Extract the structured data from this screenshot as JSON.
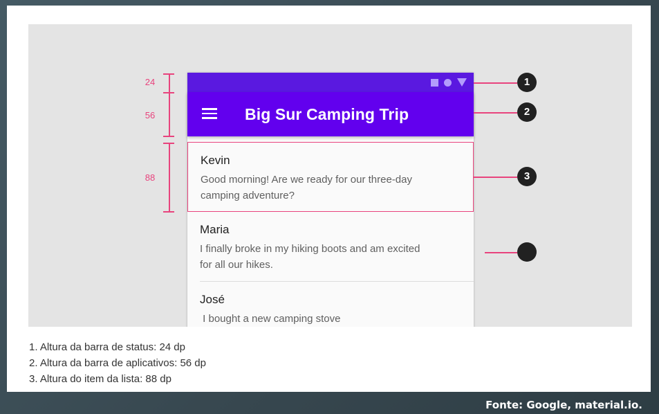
{
  "phone": {
    "app_title": "Big Sur Camping Trip",
    "list": [
      {
        "name": "Kevin",
        "text": "Good morning! Are we ready for our three-day camping adventure?"
      },
      {
        "name": "Maria",
        "text": "I finally broke in my hiking boots and am excited for all our hikes."
      },
      {
        "name": "José",
        "text": " I bought a new camping stove"
      }
    ]
  },
  "dimensions": {
    "status": "24",
    "appbar": "56",
    "item": "88"
  },
  "callouts": [
    "1",
    "2",
    "3"
  ],
  "captions": [
    "1. Altura da barra de status: 24 dp",
    "2. Altura da barra de aplicativos: 56 dp",
    "3. Altura do item da lista: 88 dp"
  ],
  "source": "Fonte: Google, material.io.",
  "colors": {
    "status_bar": "#5a19e0",
    "app_bar": "#6200ee",
    "annotation": "#e8437d"
  },
  "icons": [
    "square-icon",
    "circle-icon",
    "triangle-icon",
    "menu-icon"
  ]
}
